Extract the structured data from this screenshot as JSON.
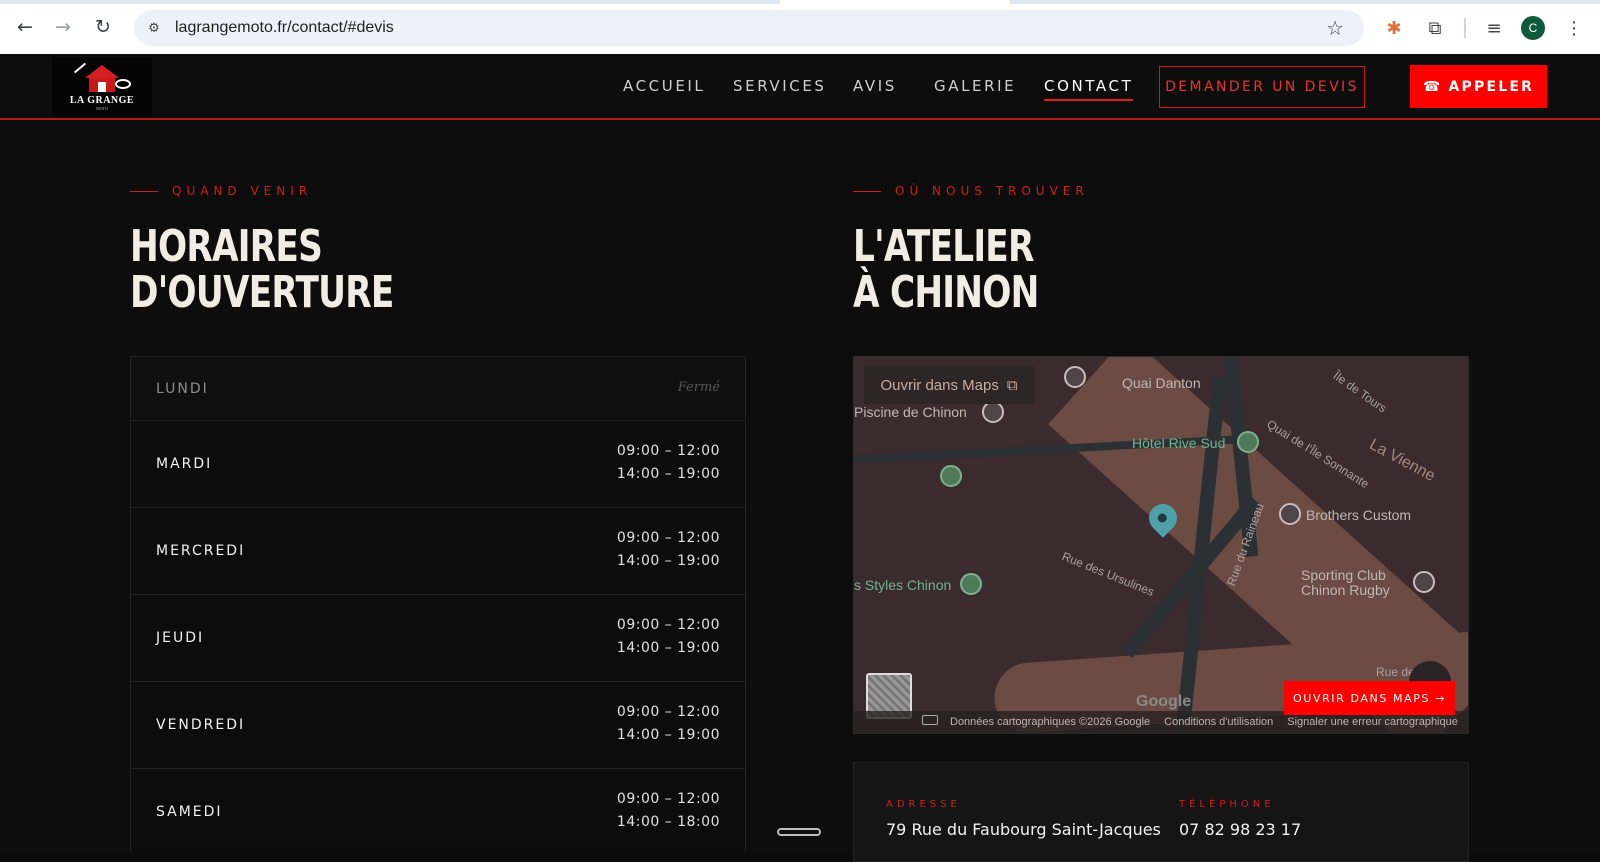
{
  "browser": {
    "url": "lagrangemoto.fr/contact/#devis",
    "back_icon": "←",
    "forward_icon": "→",
    "reload_icon": "↻",
    "site_info_icon": "⚙",
    "star_icon": "☆",
    "extension_icon": "✱",
    "puzzle_icon": "⧉",
    "media_icon": "≡",
    "menu_icon": "⋮",
    "avatar_letter": "C"
  },
  "header": {
    "logo_text": "LA GRANGE",
    "logo_sub": "MOTO",
    "nav": [
      "ACCUEIL",
      "SERVICES",
      "AVIS",
      "GALERIE",
      "CONTACT"
    ],
    "active_nav": "CONTACT",
    "devis_label": "DEMANDER UN DEVIS",
    "call_icon": "☎",
    "call_label": "APPELER"
  },
  "hours_section": {
    "eyebrow": "QUAND VENIR",
    "title_line1": "HORAIRES",
    "title_line2": "D'OUVERTURE",
    "days": [
      {
        "day": "LUNDI",
        "closed": true,
        "closed_label": "Fermé"
      },
      {
        "day": "MARDI",
        "am": "09:00 – 12:00",
        "pm": "14:00 – 19:00"
      },
      {
        "day": "MERCREDI",
        "am": "09:00 – 12:00",
        "pm": "14:00 – 19:00"
      },
      {
        "day": "JEUDI",
        "am": "09:00 – 12:00",
        "pm": "14:00 – 19:00"
      },
      {
        "day": "VENDREDI",
        "am": "09:00 – 12:00",
        "pm": "14:00 – 19:00"
      },
      {
        "day": "SAMEDI",
        "am": "09:00 – 12:00",
        "pm": "14:00 – 18:00"
      }
    ]
  },
  "location_section": {
    "eyebrow": "OÙ NOUS TROUVER",
    "title_line1": "L'ATELIER",
    "title_line2": "À CHINON",
    "map": {
      "open_in_maps": "Ouvrir dans Maps",
      "external_icon": "⧉",
      "labels": {
        "quai_danton": "Quai Danton",
        "ile_de_tours": "Île de Tours",
        "piscine": "Piscine de Chinon",
        "hotel": "Hôtel Rive Sud",
        "quai_ile": "Quai de l'Île Sonnante",
        "la_vienne": "La Vienne",
        "brothers": "Brothers Custom",
        "rue_raineau": "Rue du Raineau",
        "styles": "s Styles Chinon",
        "ursulines": "Rue des Ursulines",
        "sporting1": "Sporting Club",
        "sporting2": "Chinon Rugby",
        "rue_de": "Rue de"
      },
      "google": "Google",
      "attribution": "Données cartographiques ©2026 Google",
      "terms": "Conditions d'utilisation",
      "report": "Signaler une erreur cartographique",
      "open_maps_button": "OUVRIR DANS MAPS →"
    },
    "address_label": "ADRESSE",
    "address": "79 Rue du Faubourg Saint-Jacques",
    "phone_label": "TÉLÉPHONE",
    "phone": "07 82 98 23 17"
  },
  "colors": {
    "accent": "#ff0000",
    "accent_dark": "#d21d1d",
    "background": "#0b0b0b",
    "title": "#f2ede4"
  }
}
